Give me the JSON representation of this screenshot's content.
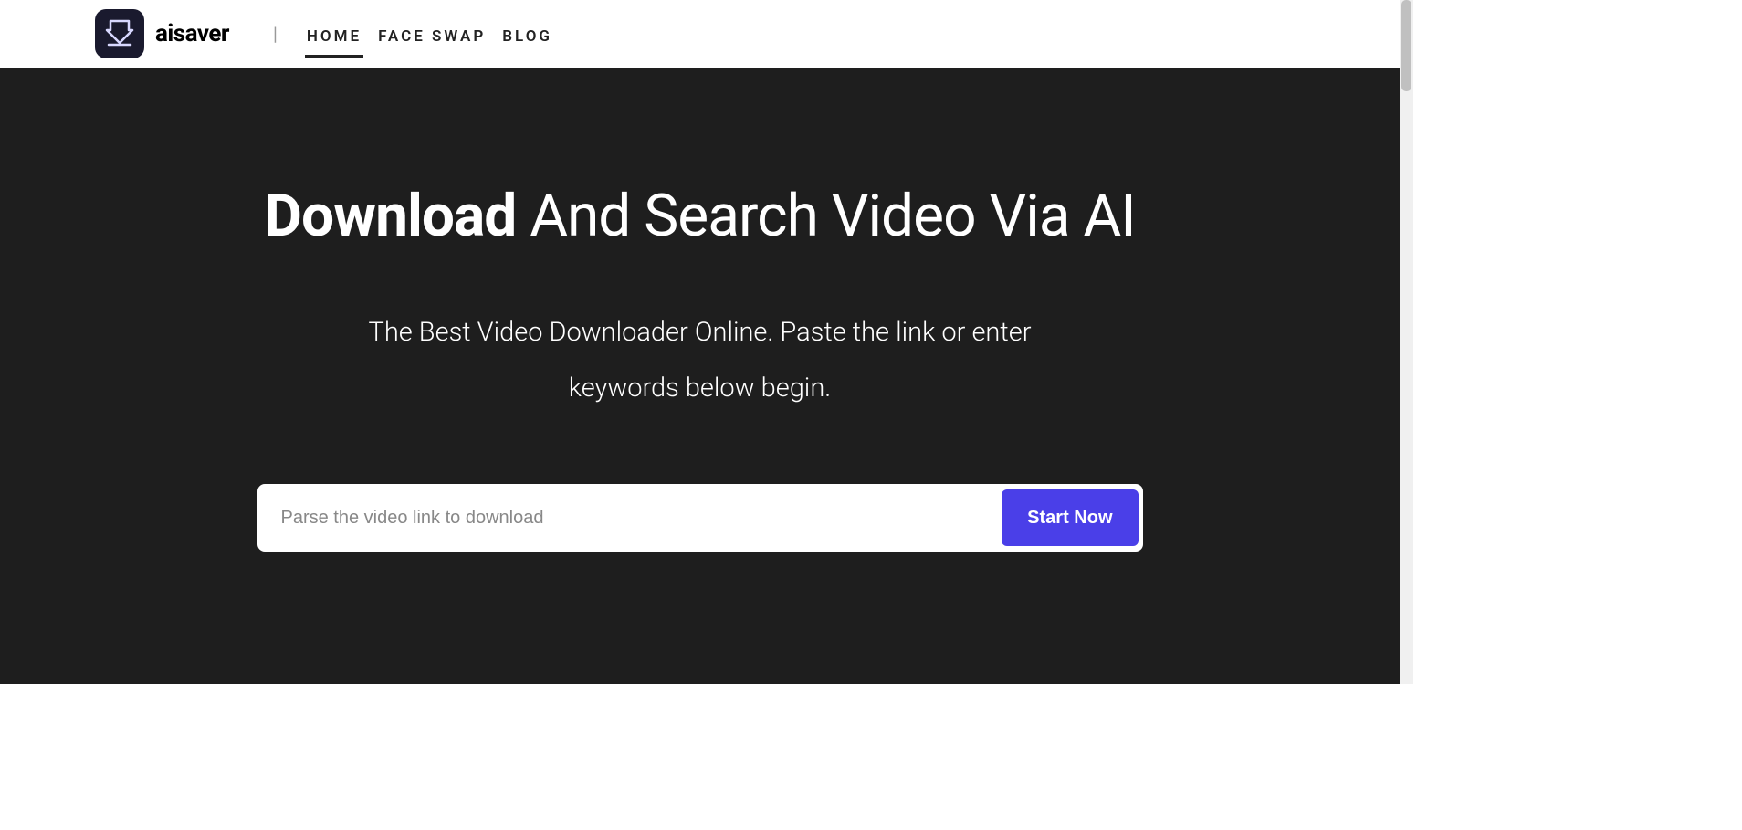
{
  "header": {
    "brand": "aisaver",
    "nav": {
      "home": "HOME",
      "faceswap": "FACE SWAP",
      "blog": "BLOG"
    }
  },
  "hero": {
    "title_strong": "Download",
    "title_rest": " And Search Video Via AI",
    "subtitle": "The Best Video Downloader Online. Paste the link or enter keywords below begin."
  },
  "search": {
    "placeholder": "Parse the video link to download",
    "button": "Start Now"
  }
}
